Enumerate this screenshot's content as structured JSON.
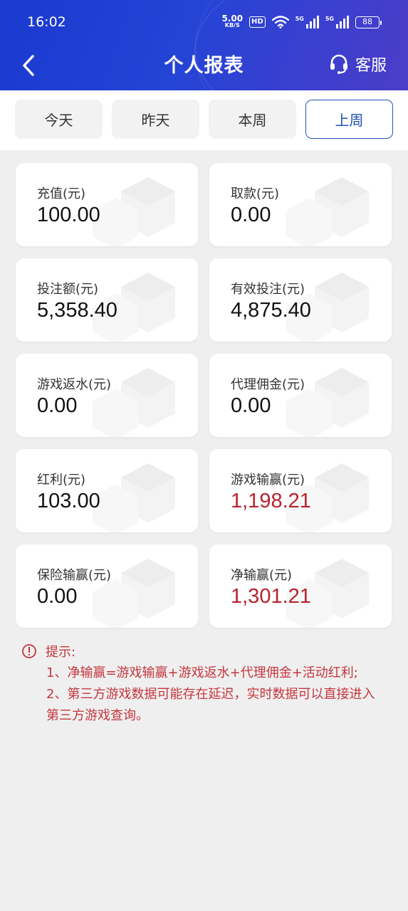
{
  "status_bar": {
    "time": "16:02",
    "net_speed": "5.00",
    "net_unit": "KB/S",
    "hd_label": "HD",
    "sim1_label": "5G",
    "sim2_label": "5G",
    "battery": "88"
  },
  "header": {
    "title": "个人报表",
    "service_label": "客服"
  },
  "tabs": [
    {
      "label": "今天",
      "active": false
    },
    {
      "label": "昨天",
      "active": false
    },
    {
      "label": "本周",
      "active": false
    },
    {
      "label": "上周",
      "active": true
    }
  ],
  "cards": [
    {
      "label": "充值(元)",
      "value": "100.00",
      "highlight": false
    },
    {
      "label": "取款(元)",
      "value": "0.00",
      "highlight": false
    },
    {
      "label": "投注额(元)",
      "value": "5,358.40",
      "highlight": false
    },
    {
      "label": "有效投注(元)",
      "value": "4,875.40",
      "highlight": false
    },
    {
      "label": "游戏返水(元)",
      "value": "0.00",
      "highlight": false
    },
    {
      "label": "代理佣金(元)",
      "value": "0.00",
      "highlight": false
    },
    {
      "label": "红利(元)",
      "value": "103.00",
      "highlight": false
    },
    {
      "label": "游戏输赢(元)",
      "value": "1,198.21",
      "highlight": true
    },
    {
      "label": "保险输赢(元)",
      "value": "0.00",
      "highlight": false
    },
    {
      "label": "净输赢(元)",
      "value": "1,301.21",
      "highlight": true
    }
  ],
  "tips": {
    "title": "提示:",
    "line1": "1、净输赢=游戏输赢+游戏返水+代理佣金+活动红利;",
    "line2": "2、第三方游戏数据可能存在延迟，实时数据可以直接进入",
    "line3": "第三方游戏查询。"
  },
  "colors": {
    "header_gradient_start": "#1a3ad0",
    "header_gradient_end": "#4a3ec8",
    "active_tab": "#1f4fb3",
    "highlight_value": "#b8232d",
    "tips_text": "#c5363d"
  }
}
